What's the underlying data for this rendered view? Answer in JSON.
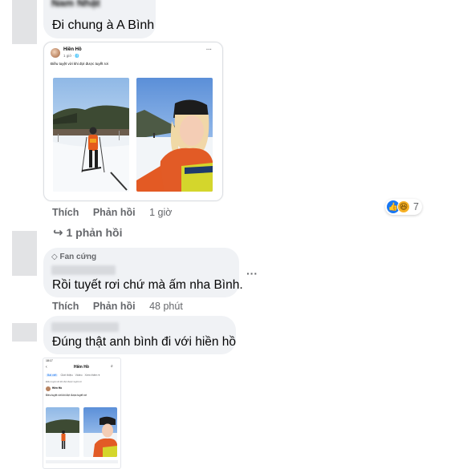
{
  "comment1": {
    "author": "Nam Nhật",
    "text": "Đi chung à A Bình",
    "shared_post": {
      "author": "Hiền Hồ",
      "meta": "1 giờ · ",
      "caption": "Điều tuyệt vời khi đợi được tuyết rơi",
      "more": "···"
    },
    "actions": {
      "like": "Thích",
      "reply": "Phản hồi",
      "time": "1 giờ"
    },
    "reaction_count": "7",
    "replies_link": "1 phản hồi"
  },
  "comment2": {
    "badge": "Fan cứng",
    "text": "Rồi tuyết rơi chứ mà ấm nha Bình.",
    "actions": {
      "like": "Thích",
      "reply": "Phản hồi",
      "time": "48 phút"
    },
    "more": "···"
  },
  "comment3": {
    "text": "Đúng thật anh bình đi với hiền hồ",
    "screenshot": {
      "status_time": "18:17",
      "page_name": "Hiền Hồ",
      "tabs": [
        "Bài viết",
        "Giới thiệu",
        "Video",
        "Xem thêm ▾"
      ],
      "tagline": "Điều tuyệt vời khi đợi được tuyết rơi",
      "post_author": "Hiền Hồ",
      "post_caption": "Điều tuyệt vời khi đợi được tuyết rơi"
    }
  },
  "colors": {
    "bubble": "#f0f2f5",
    "action_text": "#65676b",
    "like_blue": "#1877f2",
    "haha_yellow": "#f7b125"
  }
}
